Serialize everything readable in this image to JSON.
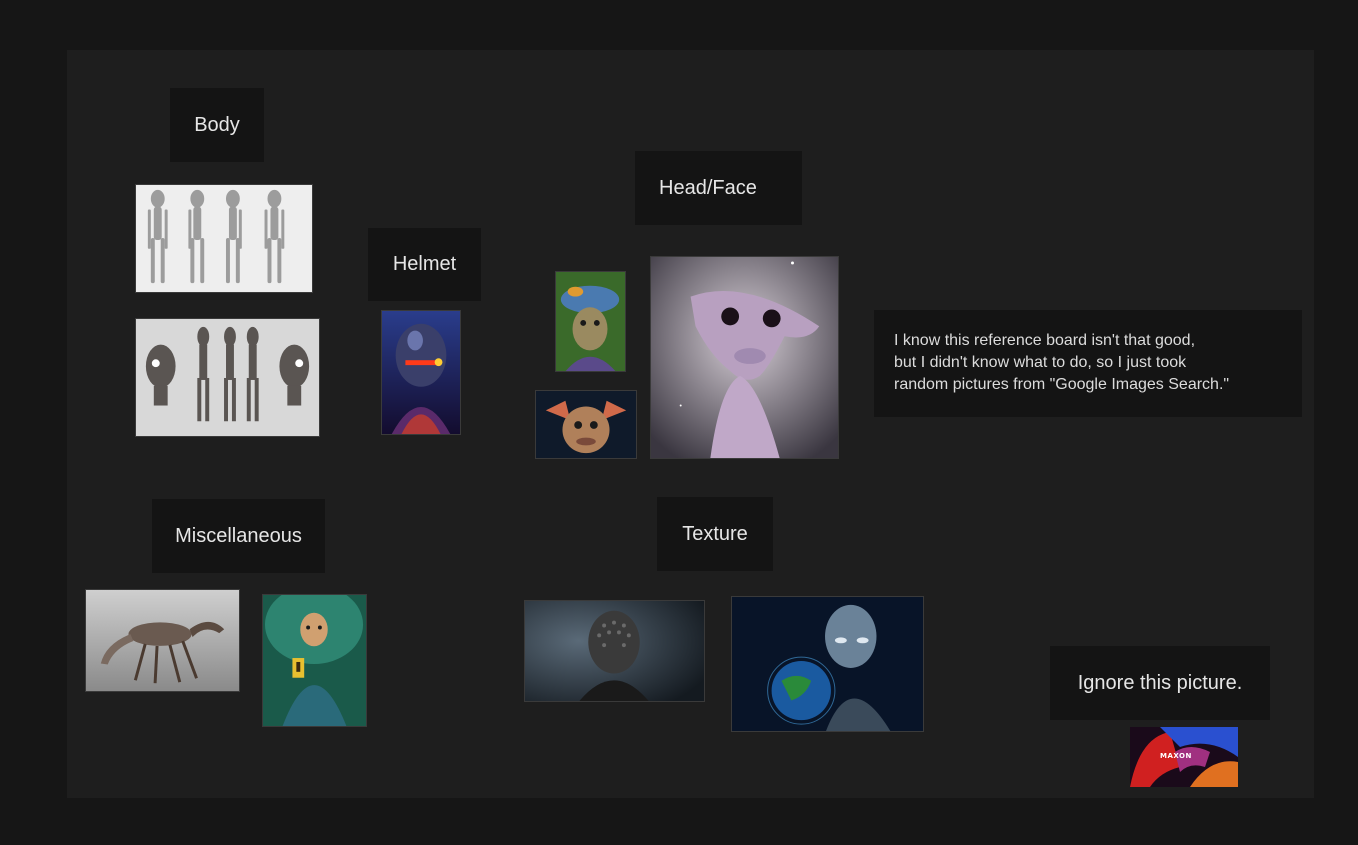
{
  "labels": {
    "body": "Body",
    "helmet": "Helmet",
    "head_face": "Head/Face",
    "miscellaneous": "Miscellaneous",
    "texture": "Texture",
    "ignore": "Ignore this picture."
  },
  "note": {
    "lines": [
      "I know this reference board isn't that good,",
      "but I didn't know what to do, so I just took",
      "random pictures from \"Google Images Search.\""
    ]
  },
  "images": {
    "logo_text": "MAXON"
  },
  "colors": {
    "background": "#161616",
    "board": "#1e1e1e",
    "label_bg": "#141414",
    "label_text": "#e6e6e6"
  }
}
